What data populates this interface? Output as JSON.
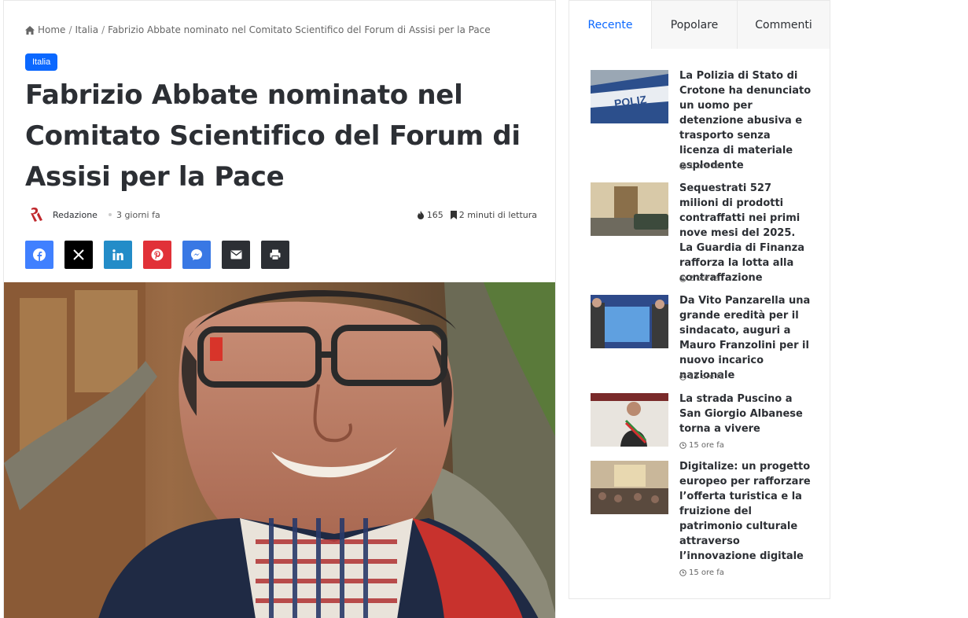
{
  "breadcrumb": {
    "home": "Home",
    "sep1": "/",
    "category": "Italia",
    "sep2": "/",
    "current": "Fabrizio Abbate nominato nel Comitato Scientifico del Forum di Assisi per la Pace"
  },
  "article": {
    "category_badge": "Italia",
    "title": "Fabrizio Abbate nominato nel Comitato Scientifico del Forum di Assisi per la Pace",
    "author": "Redazione",
    "date": "3 giorni fa",
    "views": "165",
    "reading_time": "2 minuti di lettura"
  },
  "share": [
    {
      "icon": "facebook-icon",
      "color": "#4080ff"
    },
    {
      "icon": "x-icon",
      "color": "#000000"
    },
    {
      "icon": "linkedin-icon",
      "color": "#238cc8"
    },
    {
      "icon": "pinterest-icon",
      "color": "#e13138"
    },
    {
      "icon": "messenger-icon",
      "color": "#3978e4"
    },
    {
      "icon": "email-icon",
      "color": "#2c2f34"
    },
    {
      "icon": "print-icon",
      "color": "#2c2f34"
    }
  ],
  "colors": {
    "accent": "#0b68ff",
    "text": "#2c2f34"
  },
  "sidebar": {
    "tabs": [
      {
        "label": "Recente",
        "active": true
      },
      {
        "label": "Popolare",
        "active": false
      },
      {
        "label": "Commenti",
        "active": false
      }
    ],
    "posts": [
      {
        "title": "La Polizia di Stato di Crotone ha denunciato un uomo per detenzione abusiva e trasporto senza licenza di materiale esplodente",
        "time": "1 ora fa"
      },
      {
        "title": "Sequestrati 527 milioni di prodotti contraffatti nei primi nove mesi del 2025. La Guardia di Finanza rafforza la lotta alla contraffazione",
        "time": "2 ore fa"
      },
      {
        "title": "Da Vito Panzarella una grande eredità per il sindacato, auguri a Mauro Franzolini per il nuovo incarico nazionale",
        "time": "15 ore fa"
      },
      {
        "title": "La strada Puscino a San Giorgio Albanese torna a vivere",
        "time": "15 ore fa"
      },
      {
        "title": "Digitalize: un progetto europeo per rafforzare l’offerta turistica e la fruizione del patrimonio culturale attraverso l’innovazione digitale",
        "time": "15 ore fa"
      }
    ]
  }
}
